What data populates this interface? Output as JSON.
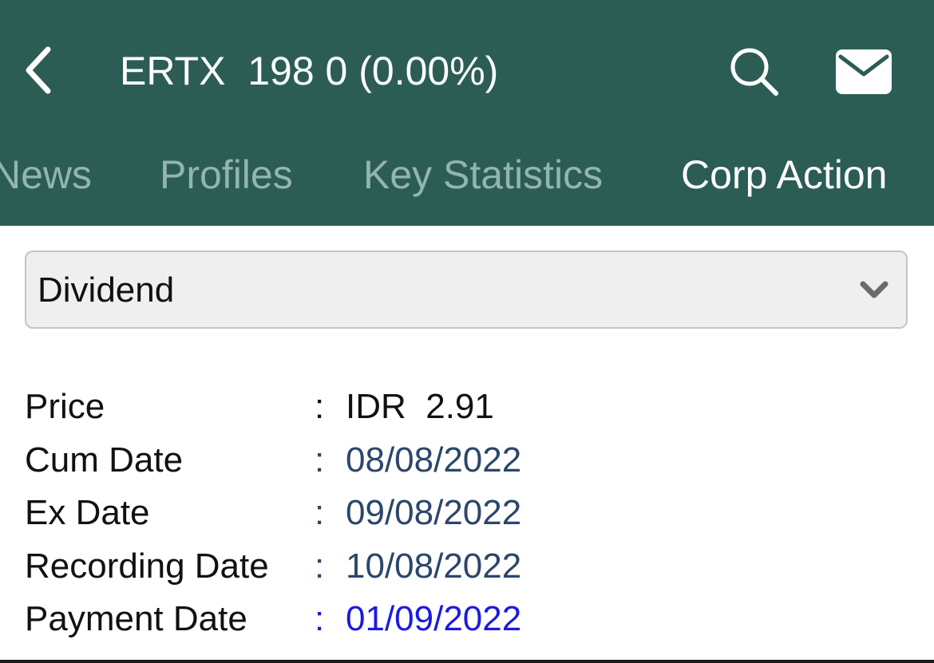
{
  "header": {
    "title": "ERTX  198 0 (0.00%)",
    "back_icon": "chevron-left-icon",
    "search_icon": "search-icon",
    "mail_icon": "mail-icon",
    "background_color": "#2b5d55"
  },
  "tabs": [
    {
      "label": "News",
      "active": false
    },
    {
      "label": "Profiles",
      "active": false
    },
    {
      "label": "Key Statistics",
      "active": false
    },
    {
      "label": "Corp Action",
      "active": true
    }
  ],
  "selector": {
    "value": "Dividend",
    "icon": "chevron-down-icon"
  },
  "details": [
    {
      "label": "Price",
      "colon": ":",
      "value": "IDR  2.91"
    },
    {
      "label": "Cum Date",
      "colon": ":",
      "value": "08/08/2022"
    },
    {
      "label": "Ex Date",
      "colon": ":",
      "value": "09/08/2022"
    },
    {
      "label": "Recording Date",
      "colon": ":",
      "value": "10/08/2022"
    },
    {
      "label": "Payment Date",
      "colon": ":",
      "value": "01/09/2022"
    }
  ]
}
